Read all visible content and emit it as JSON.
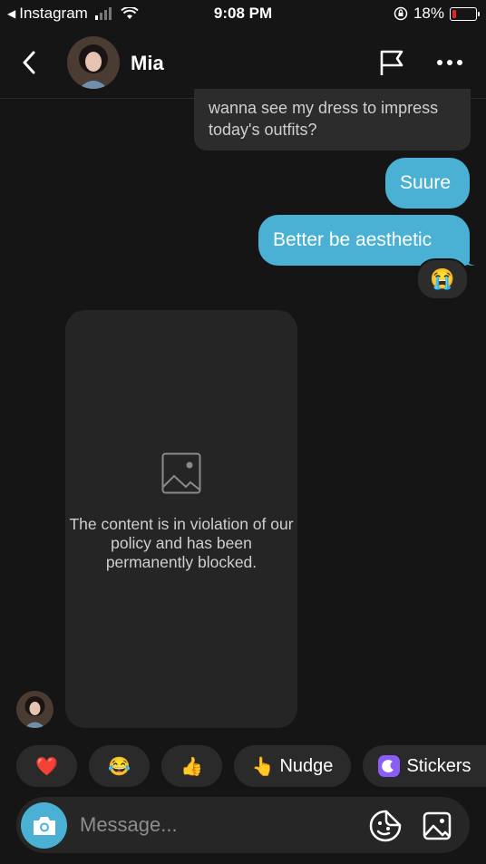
{
  "status_bar": {
    "back_app_label": "Instagram",
    "time": "9:08 PM",
    "battery_percent": "18%",
    "battery_level": 0.18
  },
  "header": {
    "contact_name": "Mia",
    "back_icon": "chevron-left-icon",
    "flag_icon": "flag-icon",
    "more_icon": "more-horizontal-icon"
  },
  "messages": [
    {
      "from": "them",
      "text": "wanna see my dress to impress today's outfits?"
    },
    {
      "from": "me",
      "text": "Suure"
    },
    {
      "from": "me",
      "text": "Better be aesthetic",
      "reaction": "😭"
    }
  ],
  "blocked_media": {
    "icon": "image-placeholder-icon",
    "text": "The content is in violation of our policy and has been permanently blocked."
  },
  "quick_reactions": [
    {
      "emoji": "❤️",
      "label": ""
    },
    {
      "emoji": "😂",
      "label": ""
    },
    {
      "emoji": "👍",
      "label": ""
    },
    {
      "emoji": "👆",
      "label": "Nudge"
    },
    {
      "emoji": "",
      "label": "Stickers"
    }
  ],
  "composer": {
    "placeholder": "Message...",
    "camera_icon": "camera-icon",
    "sticker_icon": "sticker-icon",
    "gallery_icon": "gallery-icon"
  },
  "colors": {
    "background": "#151515",
    "accent_blue": "#4ab1d4",
    "bubble_grey": "#2c2c2c",
    "sticker_purple": "#8b5cf6"
  }
}
